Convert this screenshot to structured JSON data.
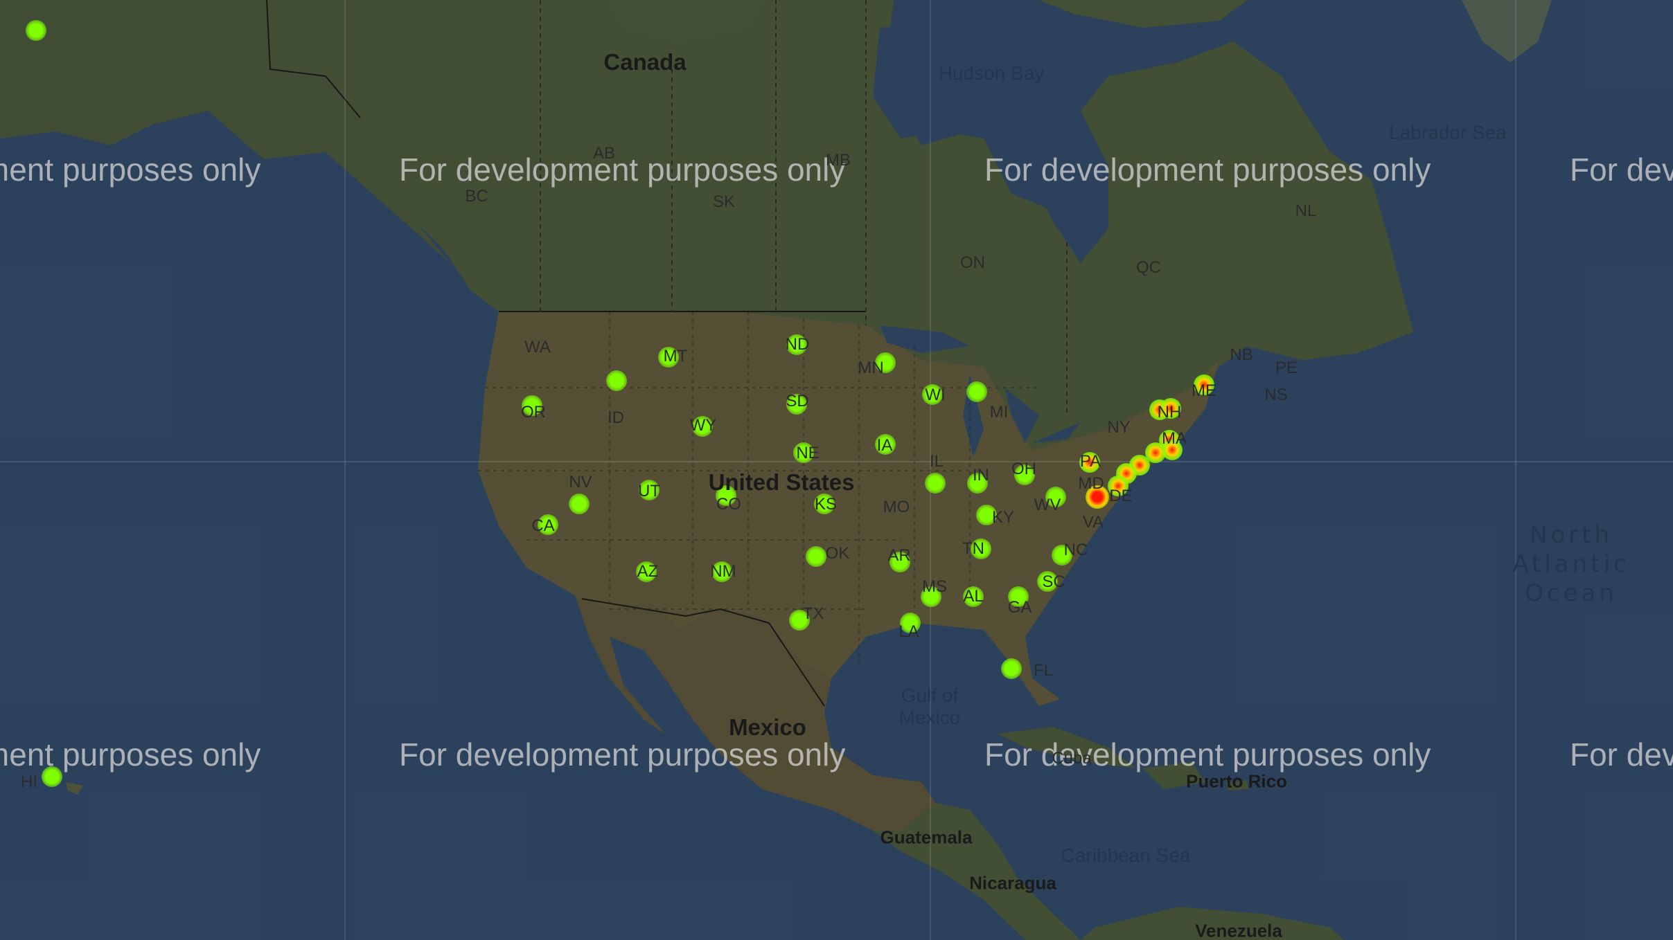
{
  "map": {
    "watermark": "For development purposes only",
    "countries": [
      {
        "id": "canada",
        "text": "Canada"
      },
      {
        "id": "united-states",
        "text": "United States"
      },
      {
        "id": "mexico",
        "text": "Mexico"
      },
      {
        "id": "guatemala",
        "text": "Guatemala"
      },
      {
        "id": "nicaragua",
        "text": "Nicaragua"
      },
      {
        "id": "puerto-rico",
        "text": "Puerto Rico"
      },
      {
        "id": "venezuela",
        "text": "Venezuela"
      }
    ],
    "waters": [
      {
        "id": "hudson-bay",
        "text": "Hudson Bay"
      },
      {
        "id": "labrador-sea",
        "text": "Labrador Sea"
      },
      {
        "id": "gulf-of-mexico",
        "text": "Gulf of\nMexico"
      },
      {
        "id": "caribbean-sea",
        "text": "Caribbean Sea"
      },
      {
        "id": "north-atlantic",
        "text": "North\nAtlantic\nOcean"
      }
    ],
    "regions": [
      "BC",
      "AB",
      "SK",
      "MB",
      "ON",
      "QC",
      "NL",
      "NB",
      "PE",
      "NS",
      "WA",
      "OR",
      "CA",
      "NV",
      "ID",
      "MT",
      "WY",
      "UT",
      "CO",
      "AZ",
      "NM",
      "ND",
      "SD",
      "NE",
      "KS",
      "OK",
      "TX",
      "MN",
      "IA",
      "MO",
      "AR",
      "LA",
      "WI",
      "IL",
      "MI",
      "IN",
      "OH",
      "KY",
      "TN",
      "MS",
      "AL",
      "GA",
      "FL",
      "SC",
      "NC",
      "VA",
      "WV",
      "MD",
      "DE",
      "PA",
      "NY",
      "NH",
      "MA",
      "ME",
      "HI",
      "Cuba"
    ],
    "heat_colors": {
      "low": "#7fff00",
      "mid": "#ffd000",
      "high": "#ff1a00"
    }
  }
}
